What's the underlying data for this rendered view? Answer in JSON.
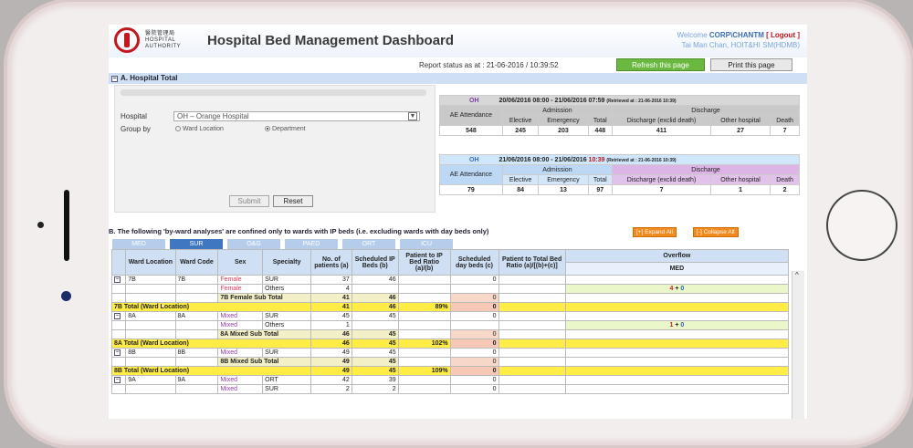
{
  "header": {
    "org_line1": "醫院管理局",
    "org_line2": "HOSPITAL",
    "org_line3": "AUTHORITY",
    "title": "Hospital Bed Management Dashboard",
    "welcome": "Welcome",
    "user": "CORP\\CHANTM",
    "logout": "[ Logout ]",
    "user_detail": "Tai Man Chan, HOIT&HI SM(HDMB)"
  },
  "toolbar": {
    "status": "Report status as at : 21-06-2016 / 10:39:52",
    "refresh_label": "Refresh this page",
    "print_label": "Print this page"
  },
  "sectionA": {
    "toggle": "−",
    "title": "A. Hospital Total",
    "hospital_label": "Hospital",
    "hospital_value": "OH – Orange Hospital",
    "groupby_label": "Group by",
    "option_ward": "Ward Location",
    "option_dept": "Department",
    "submit_label": "Submit",
    "reset_label": "Reset"
  },
  "stats1": {
    "hospital": "OH",
    "period": "20/06/2016 08:00 - 21/06/2016 07:59",
    "retrieved": "(Retrieved at : 21-06-2016 10:39)",
    "ae": "AE Attendance",
    "admission": "Admission",
    "discharge": "Discharge",
    "elective": "Elective",
    "emergency": "Emergency",
    "total": "Total",
    "dis_excl": "Discharge (exclid death)",
    "other": "Other hospital",
    "death": "Death",
    "values": [
      "548",
      "245",
      "203",
      "448",
      "411",
      "27",
      "7"
    ]
  },
  "stats2": {
    "hospital": "OH",
    "period": "21/06/2016 08:00 - 21/06/2016",
    "time": "10:39",
    "retrieved": "(Retrieved at : 21-06-2016 10:39)",
    "values": [
      "79",
      "84",
      "13",
      "97",
      "7",
      "1",
      "2"
    ]
  },
  "sectionB": {
    "title": "B. The following 'by-ward analyses' are confined only to wards with IP beds (i.e. excluding wards with day beds only)",
    "expand": "[+] Expand All",
    "collapse": "[-] Collapse All",
    "tabs": [
      "MED",
      "SUR",
      "O&G",
      "PAED",
      "ORT",
      "ICU"
    ]
  },
  "grid": {
    "headers": [
      "Ward Location",
      "Ward Code",
      "Sex",
      "Specialty",
      "No. of patients (a)",
      "Scheduled IP Beds (b)",
      "Patient to IP Bed Ratio (a)/(b)",
      "Scheduled day beds (c)",
      "Patient to Total Bed Ratio (a)/[(b)+(c)]",
      "Overflow"
    ],
    "overflow_sub": "MED",
    "rows": [
      {
        "loc": "7B",
        "code": "7B",
        "sex": "Female",
        "spec": "SUR",
        "a": "37",
        "b": "46",
        "ratio": "",
        "c": "0",
        "tr": "",
        "ovf": ""
      },
      {
        "loc": "",
        "code": "",
        "sex": "Female",
        "spec": "Others",
        "a": "4",
        "b": "",
        "ratio": "",
        "c": "",
        "tr": "",
        "ovf": "4 + 0"
      },
      {
        "sub": "7B Female Sub Total",
        "a": "41",
        "b": "46",
        "c": "0"
      },
      {
        "tot": "7B Total (Ward Location)",
        "a": "41",
        "b": "46",
        "ratio": "89%",
        "c": "0"
      },
      {
        "loc": "8A",
        "code": "8A",
        "sex": "Mixed",
        "spec": "SUR",
        "a": "45",
        "b": "45",
        "ratio": "",
        "c": "0",
        "tr": "",
        "ovf": ""
      },
      {
        "loc": "",
        "code": "",
        "sex": "Mixed",
        "spec": "Others",
        "a": "1",
        "b": "",
        "ratio": "",
        "c": "",
        "tr": "",
        "ovf": "1 + 0"
      },
      {
        "sub": "8A Mixed Sub Total",
        "a": "46",
        "b": "45",
        "c": "0"
      },
      {
        "tot": "8A Total (Ward Location)",
        "a": "46",
        "b": "45",
        "ratio": "102%",
        "c": "0"
      },
      {
        "loc": "8B",
        "code": "8B",
        "sex": "Mixed",
        "spec": "SUR",
        "a": "49",
        "b": "45",
        "ratio": "",
        "c": "0",
        "tr": "",
        "ovf": ""
      },
      {
        "sub": "8B Mixed Sub Total",
        "a": "49",
        "b": "45",
        "c": "0"
      },
      {
        "tot": "8B Total (Ward Location)",
        "a": "49",
        "b": "45",
        "ratio": "109%",
        "c": "0"
      },
      {
        "loc": "9A",
        "code": "9A",
        "sex": "Mixed",
        "spec": "ORT",
        "a": "42",
        "b": "39",
        "ratio": "",
        "c": "0",
        "tr": "",
        "ovf": ""
      },
      {
        "loc": "",
        "code": "",
        "sex": "Mixed",
        "spec": "SUR",
        "a": "2",
        "b": "2",
        "ratio": "",
        "c": "0",
        "tr": "",
        "ovf": ""
      }
    ]
  }
}
